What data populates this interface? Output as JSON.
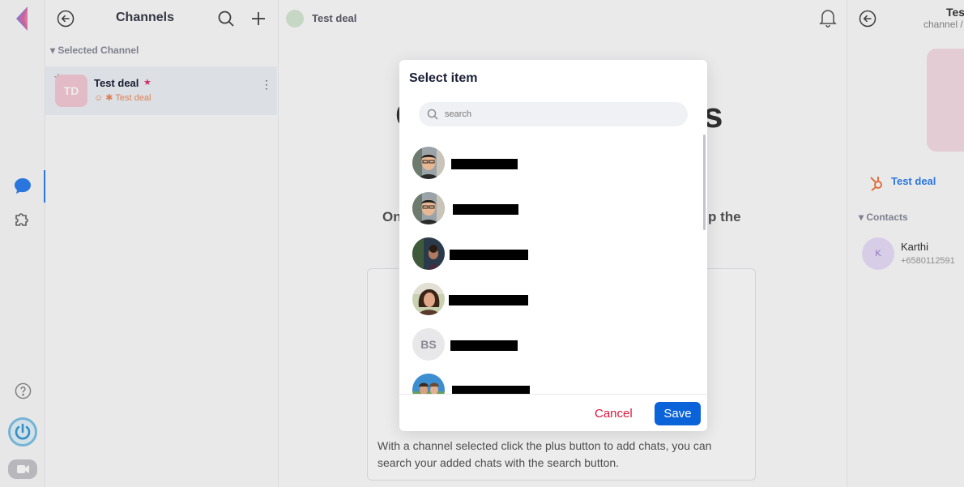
{
  "sidebar_rail": {
    "icons": [
      "app-logo-icon",
      "chat-icon",
      "puzzle-icon",
      "help-icon",
      "power-icon",
      "video-icon"
    ]
  },
  "channels_panel": {
    "title": "Channels",
    "section_label": "Selected Channel",
    "item": {
      "initials": "TD",
      "name": "Test deal",
      "subtitle": "Test deal"
    }
  },
  "main": {
    "top_title": "Test deal",
    "big_text_left": "C",
    "big_text_right": "s",
    "sub_text_left": "On",
    "sub_text_right": "p the",
    "card_text": "With a channel selected click the plus button to add chats, you can search your added chats with the search button."
  },
  "right_panel": {
    "title": "Tes",
    "subtitle": "channel /",
    "deal_link": "Test deal",
    "contacts_label": "Contacts",
    "contact": {
      "initial": "K",
      "name": "Karthi",
      "phone": "+6580112591"
    }
  },
  "modal": {
    "title": "Select item",
    "search_placeholder": "search",
    "items": [
      {
        "name": "████████████",
        "avatar": "photo-man-glasses"
      },
      {
        "name": "████████████",
        "avatar": "photo-man-glasses"
      },
      {
        "name": "██████████████",
        "avatar": "photo-dark"
      },
      {
        "name": "██████████████",
        "avatar": "photo-woman"
      },
      {
        "name": "████████████",
        "initials": "BS"
      },
      {
        "name": "██████████████",
        "avatar": "photo-couple"
      }
    ],
    "cancel_label": "Cancel",
    "save_label": "Save"
  },
  "colors": {
    "accent_blue": "#0a63d8",
    "cancel_red": "#e0143c",
    "brand_pink": "#e53170"
  }
}
